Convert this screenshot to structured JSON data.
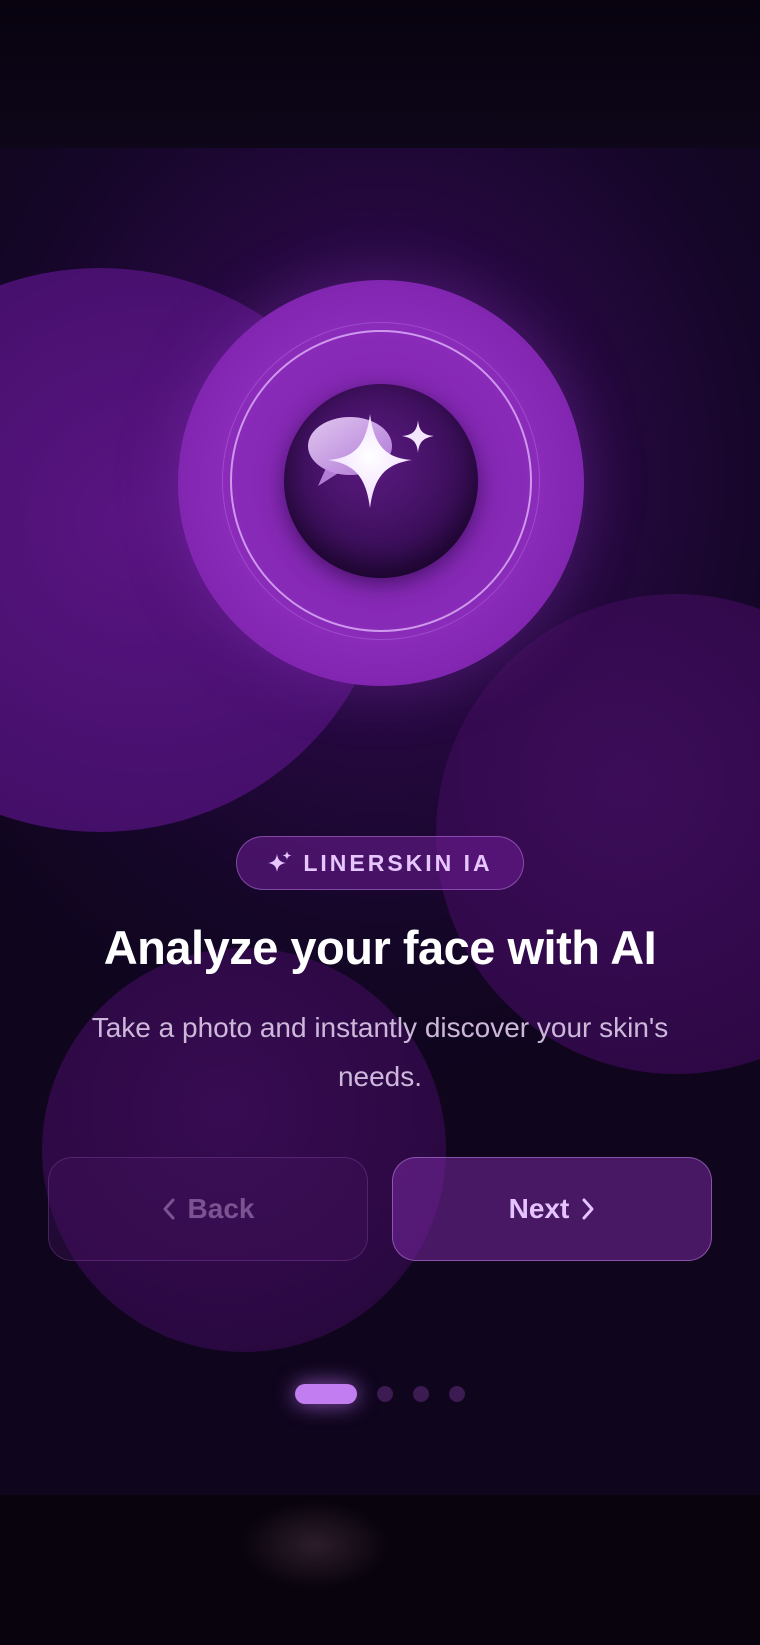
{
  "badge": {
    "label": "LINERSKIN IA",
    "icon": "sparkles-icon"
  },
  "headline": "Analyze your face with AI",
  "subtitle": "Take a photo and instantly discover your skin's needs.",
  "buttons": {
    "back_label": "Back",
    "next_label": "Next"
  },
  "pagination": {
    "current": 1,
    "total": 4
  },
  "colors": {
    "accent": "#c27df0",
    "background": "#0b0414",
    "halo": "#8a2bba"
  }
}
